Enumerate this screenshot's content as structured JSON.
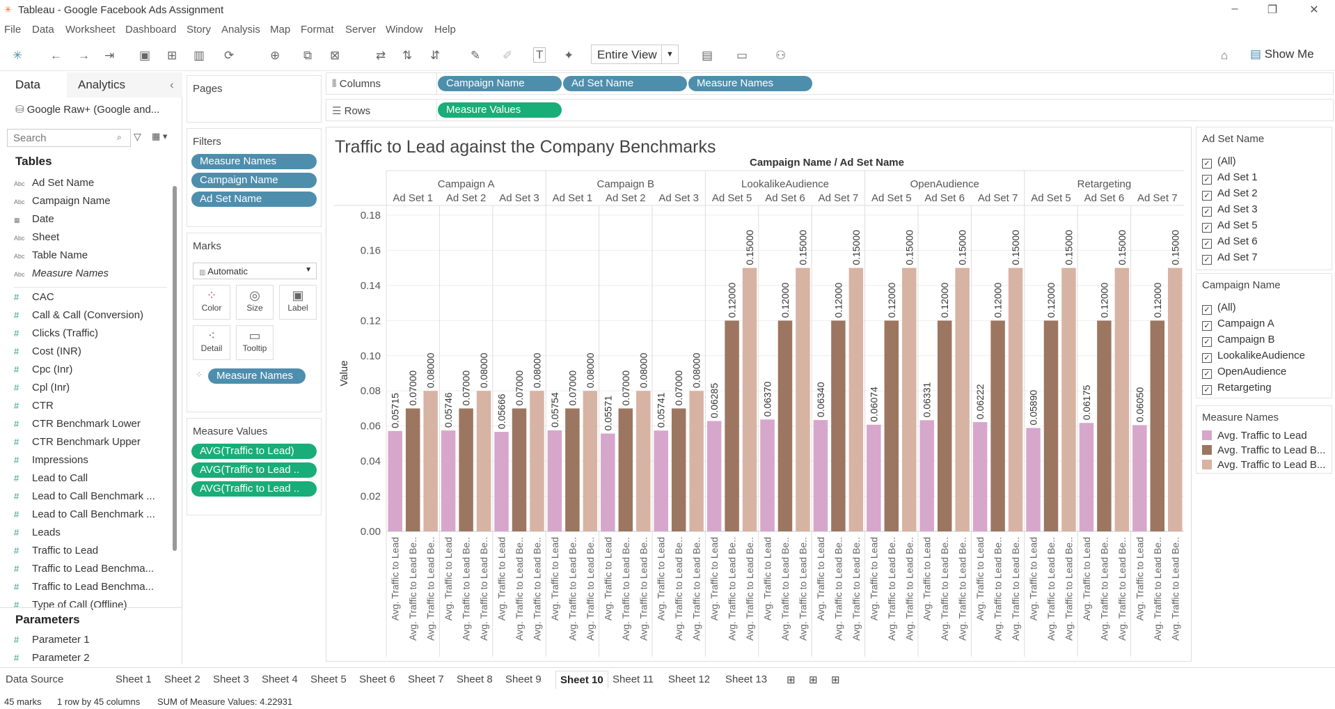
{
  "window": {
    "title": "Tableau - Google Facebook Ads Assignment"
  },
  "menu": [
    "File",
    "Data",
    "Worksheet",
    "Dashboard",
    "Story",
    "Analysis",
    "Map",
    "Format",
    "Server",
    "Window",
    "Help"
  ],
  "toolbar": {
    "fit": "Entire View",
    "show_me": "Show Me"
  },
  "left": {
    "tab_data": "Data",
    "tab_analytics": "Analytics",
    "datasource": "Google Raw+ (Google and...",
    "search_placeholder": "Search",
    "tables_title": "Tables",
    "dims": [
      "Ad Set Name",
      "Campaign Name",
      "Date",
      "Sheet",
      "Table Name",
      "Measure Names"
    ],
    "measures": [
      "CAC",
      "Call & Call (Conversion)",
      "Clicks (Traffic)",
      "Cost (INR)",
      "Cpc (Inr)",
      "Cpl (Inr)",
      "CTR",
      "CTR Benchmark Lower",
      "CTR Benchmark Upper",
      "Impressions",
      "Lead to Call",
      "Lead to Call Benchmark ...",
      "Lead to Call Benchmark ...",
      "Leads",
      "Traffic to Lead",
      "Traffic to Lead Benchma...",
      "Traffic to Lead Benchma...",
      "Type of Call (Offline)"
    ],
    "params_title": "Parameters",
    "params": [
      "Parameter 1",
      "Parameter 2"
    ]
  },
  "pages": {
    "title": "Pages"
  },
  "filters": {
    "title": "Filters",
    "items": [
      "Measure Names",
      "Campaign Name",
      "Ad Set Name"
    ]
  },
  "marks": {
    "title": "Marks",
    "type": "Automatic",
    "buttons": [
      "Color",
      "Size",
      "Label",
      "Detail",
      "Tooltip"
    ],
    "pill": "Measure Names"
  },
  "measure_values": {
    "title": "Measure Values",
    "items": [
      "AVG(Traffic to Lead)",
      "AVG(Traffic to Lead ..",
      "AVG(Traffic to Lead .."
    ]
  },
  "shelves": {
    "columns_label": "Columns",
    "columns": [
      "Campaign Name",
      "Ad Set Name",
      "Measure Names"
    ],
    "rows_label": "Rows",
    "rows": [
      "Measure Values"
    ]
  },
  "legend_adset": {
    "title": "Ad Set Name",
    "items": [
      "(All)",
      "Ad Set 1",
      "Ad Set 2",
      "Ad Set 3",
      "Ad Set 5",
      "Ad Set 6",
      "Ad Set 7"
    ]
  },
  "legend_campaign": {
    "title": "Campaign Name",
    "items": [
      "(All)",
      "Campaign A",
      "Campaign B",
      "LookalikeAudience",
      "OpenAudience",
      "Retargeting"
    ]
  },
  "legend_measures": {
    "title": "Measure Names",
    "items": [
      {
        "label": "Avg. Traffic to Lead",
        "color": "#d7a6cb"
      },
      {
        "label": "Avg. Traffic to Lead B...",
        "color": "#9c7660"
      },
      {
        "label": "Avg. Traffic to Lead B...",
        "color": "#d7b3a3"
      }
    ]
  },
  "sheets": [
    "Data Source",
    "Sheet 1",
    "Sheet 2",
    "Sheet 3",
    "Sheet 4",
    "Sheet 5",
    "Sheet 6",
    "Sheet 7",
    "Sheet 8",
    "Sheet 9",
    "Sheet 10",
    "Sheet 11",
    "Sheet 12",
    "Sheet 13"
  ],
  "active_sheet": "Sheet 10",
  "status": {
    "marks": "45 marks",
    "rowscols": "1 row by 45 columns",
    "sum": "SUM of Measure Values: 4.22931"
  },
  "chart_data": {
    "type": "bar",
    "title": "Traffic to Lead against the Company Benchmarks",
    "header": "Campaign Name / Ad Set Name",
    "ylabel": "Value",
    "ylim": [
      0,
      0.18
    ],
    "yticks": [
      "0.00",
      "0.02",
      "0.04",
      "0.06",
      "0.08",
      "0.10",
      "0.12",
      "0.14",
      "0.16",
      "0.18"
    ],
    "measure_labels": [
      "Avg. Traffic to Lead",
      "Avg. Traffic to Lead Be..",
      "Avg. Traffic to Lead Be.."
    ],
    "colors": [
      "#d7a6cb",
      "#9c7660",
      "#d7b3a3"
    ],
    "campaigns": [
      {
        "name": "Campaign A",
        "adsets": [
          {
            "name": "Ad Set 1",
            "values": [
              0.05715,
              0.07,
              0.08
            ],
            "labels": [
              "0.05715",
              "0.07000",
              "0.08000"
            ]
          },
          {
            "name": "Ad Set 2",
            "values": [
              0.05746,
              0.07,
              0.08
            ],
            "labels": [
              "0.05746",
              "0.07000",
              "0.08000"
            ]
          },
          {
            "name": "Ad Set 3",
            "values": [
              0.05666,
              0.07,
              0.08
            ],
            "labels": [
              "0.05666",
              "0.07000",
              "0.08000"
            ]
          }
        ]
      },
      {
        "name": "Campaign B",
        "adsets": [
          {
            "name": "Ad Set 1",
            "values": [
              0.05754,
              0.07,
              0.08
            ],
            "labels": [
              "0.05754",
              "0.07000",
              "0.08000"
            ]
          },
          {
            "name": "Ad Set 2",
            "values": [
              0.05571,
              0.07,
              0.08
            ],
            "labels": [
              "0.05571",
              "0.07000",
              "0.08000"
            ]
          },
          {
            "name": "Ad Set 3",
            "values": [
              0.05741,
              0.07,
              0.08
            ],
            "labels": [
              "0.05741",
              "0.07000",
              "0.08000"
            ]
          }
        ]
      },
      {
        "name": "LookalikeAudience",
        "adsets": [
          {
            "name": "Ad Set 5",
            "values": [
              0.06285,
              0.12,
              0.15
            ],
            "labels": [
              "0.06285",
              "0.12000",
              "0.15000"
            ]
          },
          {
            "name": "Ad Set 6",
            "values": [
              0.0637,
              0.12,
              0.15
            ],
            "labels": [
              "0.06370",
              "0.12000",
              "0.15000"
            ]
          },
          {
            "name": "Ad Set 7",
            "values": [
              0.0634,
              0.12,
              0.15
            ],
            "labels": [
              "0.06340",
              "0.12000",
              "0.15000"
            ]
          }
        ]
      },
      {
        "name": "OpenAudience",
        "adsets": [
          {
            "name": "Ad Set 5",
            "values": [
              0.06074,
              0.12,
              0.15
            ],
            "labels": [
              "0.06074",
              "0.12000",
              "0.15000"
            ]
          },
          {
            "name": "Ad Set 6",
            "values": [
              0.06331,
              0.12,
              0.15
            ],
            "labels": [
              "0.06331",
              "0.12000",
              "0.15000"
            ]
          },
          {
            "name": "Ad Set 7",
            "values": [
              0.06222,
              0.12,
              0.15
            ],
            "labels": [
              "0.06222",
              "0.12000",
              "0.15000"
            ]
          }
        ]
      },
      {
        "name": "Retargeting",
        "adsets": [
          {
            "name": "Ad Set 5",
            "values": [
              0.0589,
              0.12,
              0.15
            ],
            "labels": [
              "0.05890",
              "0.12000",
              "0.15000"
            ]
          },
          {
            "name": "Ad Set 6",
            "values": [
              0.06175,
              0.12,
              0.15
            ],
            "labels": [
              "0.06175",
              "0.12000",
              "0.15000"
            ]
          },
          {
            "name": "Ad Set 7",
            "values": [
              0.0605,
              0.12,
              0.15
            ],
            "labels": [
              "0.06050",
              "0.12000",
              "0.15000"
            ]
          }
        ]
      }
    ]
  }
}
